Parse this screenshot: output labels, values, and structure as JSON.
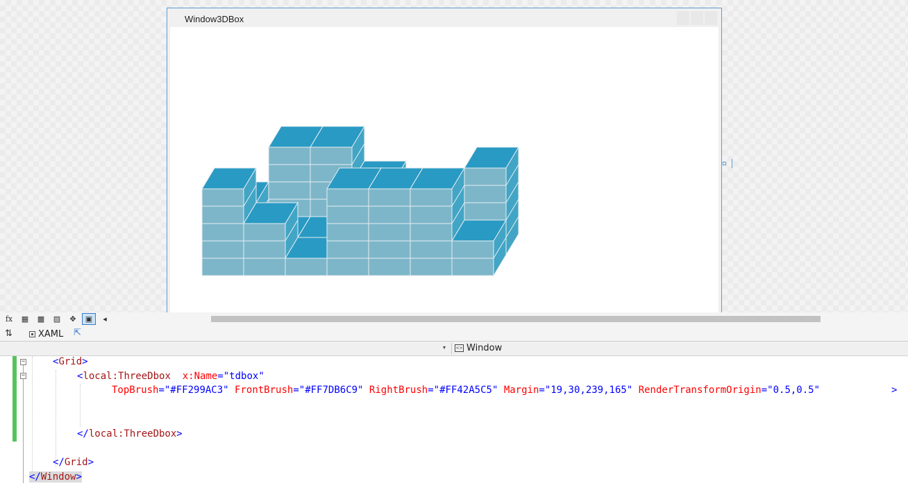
{
  "window": {
    "title": "Window3DBox",
    "cube_colors": {
      "top": "#299AC3",
      "front": "#7DB6C9",
      "right": "#42A5C5"
    }
  },
  "toolbar": {
    "buttons": [
      {
        "icon": "fx-icon",
        "glyph": "fx"
      },
      {
        "icon": "grid-icon",
        "glyph": "▦"
      },
      {
        "icon": "snap-grid-icon",
        "glyph": "▩"
      },
      {
        "icon": "artboard-icon",
        "glyph": "▨"
      },
      {
        "icon": "snap-lines-icon",
        "glyph": "✥"
      },
      {
        "icon": "device-icon",
        "glyph": "▣"
      }
    ],
    "collapse_glyph": "◂"
  },
  "tabbar": {
    "swap_glyph": "⇅",
    "xaml_label": "XAML",
    "popout_glyph": "⇱"
  },
  "navbar": {
    "arrow": "▾",
    "element_icon_glyph": "<>",
    "element": "Window"
  },
  "editor": {
    "more_glyph": ">",
    "lines": [
      {
        "open": "<",
        "tag": "Grid",
        "close": ">"
      },
      {
        "open": "<",
        "tag": "local:ThreeDbox",
        "attr": "x:Name",
        "eq": "=",
        "value": "\"tdbox\""
      },
      {
        "attrs": [
          {
            "name": "TopBrush",
            "eq": "=",
            "value": "\"#FF299AC3\""
          },
          {
            "name": "FrontBrush",
            "eq": "=",
            "value": "\"#FF7DB6C9\""
          },
          {
            "name": "RightBrush",
            "eq": "=",
            "value": "\"#FF42A5C5\""
          },
          {
            "name": "Margin",
            "eq": "=",
            "value": "\"19,30,239,165\""
          },
          {
            "name": "RenderTransformOrigin",
            "eq": "=",
            "value": "\"0.5,0.5\""
          }
        ]
      },
      {
        "open": "</",
        "tag": "local:ThreeDbox",
        "close": ">"
      },
      {
        "open": "</",
        "tag": "Grid",
        "close": ">"
      },
      {
        "open": "</",
        "tag": "Window",
        "close": ">"
      }
    ]
  }
}
